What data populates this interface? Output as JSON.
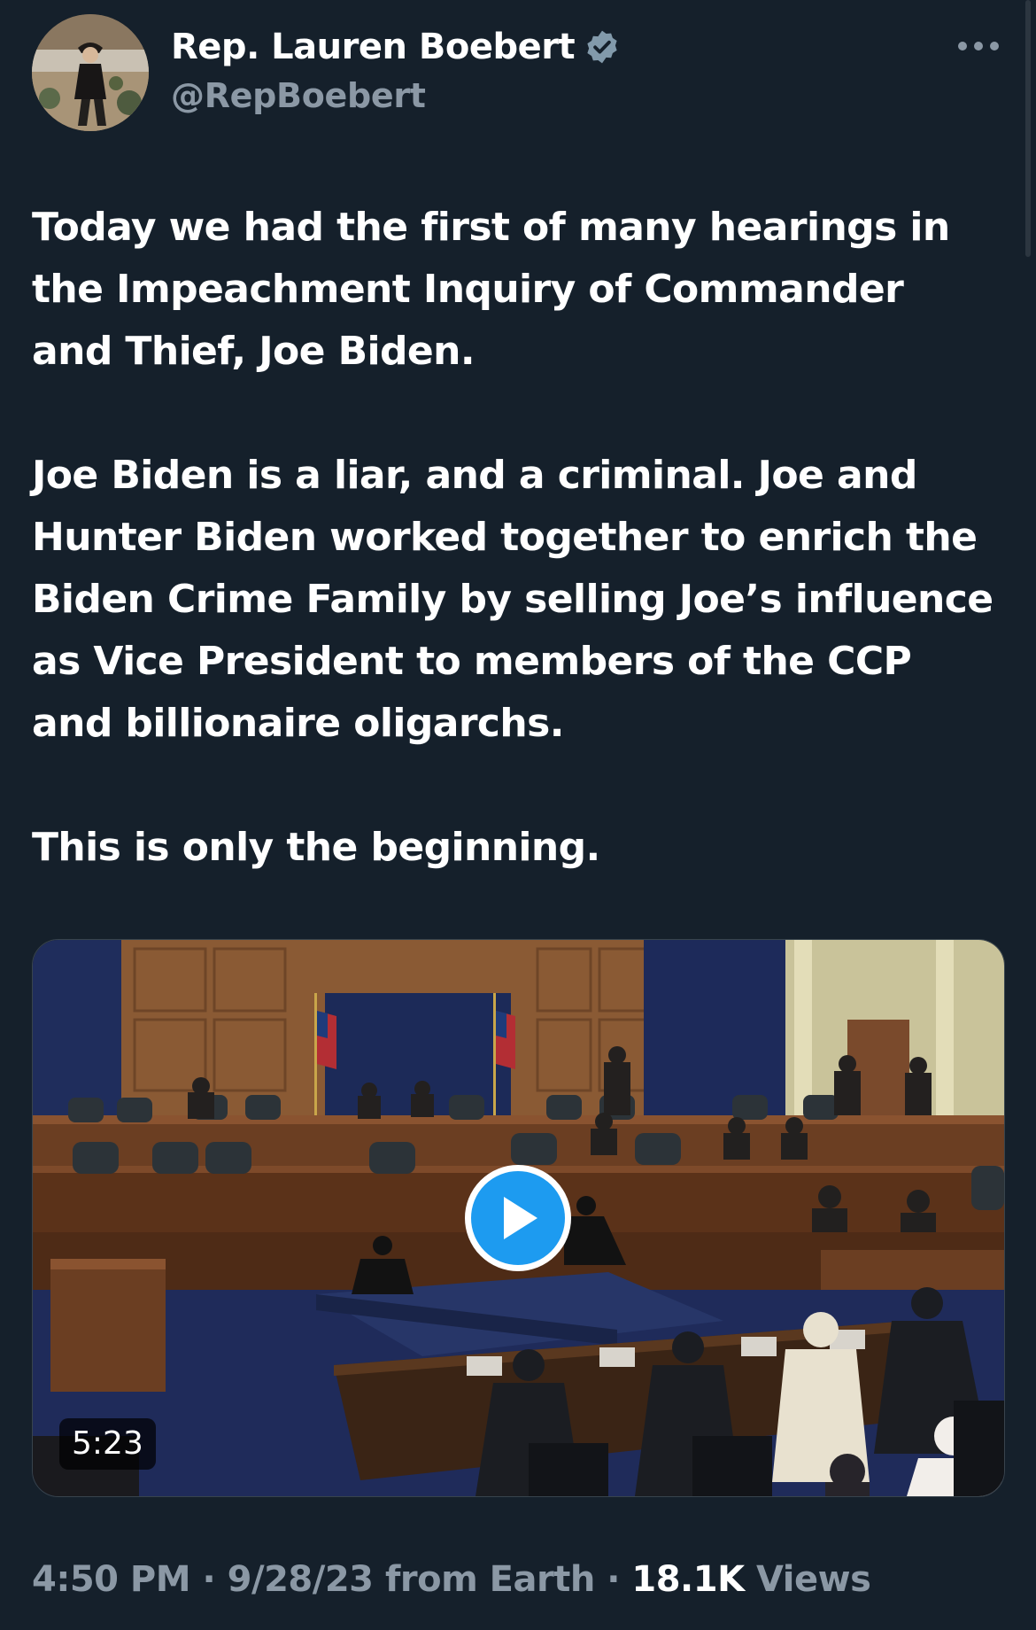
{
  "author": {
    "display_name": "Rep. Lauren Boebert",
    "handle": "@RepBoebert",
    "verified": true,
    "avatar_icon": "profile-photo"
  },
  "tweet": {
    "paragraphs": [
      "Today we had the first of many hearings in\nthe Impeachment Inquiry of Commander\nand Thief, Joe Biden.",
      "Joe Biden is a liar, and a criminal. Joe and\nHunter Biden worked together to enrich the\nBiden Crime Family by selling Joe’s influence\nas Vice President to members of the CCP\nand billionaire oligarchs.",
      "This is only the beginning."
    ]
  },
  "media": {
    "type": "video",
    "duration": "5:23",
    "play_icon": "play-icon"
  },
  "meta": {
    "time": "4:50 PM",
    "separator": "·",
    "date": "9/28/23",
    "source": "from Earth",
    "views_count": "18.1K",
    "views_label": "Views"
  },
  "colors": {
    "background": "#15202b",
    "text": "#ffffff",
    "secondary_text": "#8b98a5",
    "accent": "#1d9bf0"
  }
}
